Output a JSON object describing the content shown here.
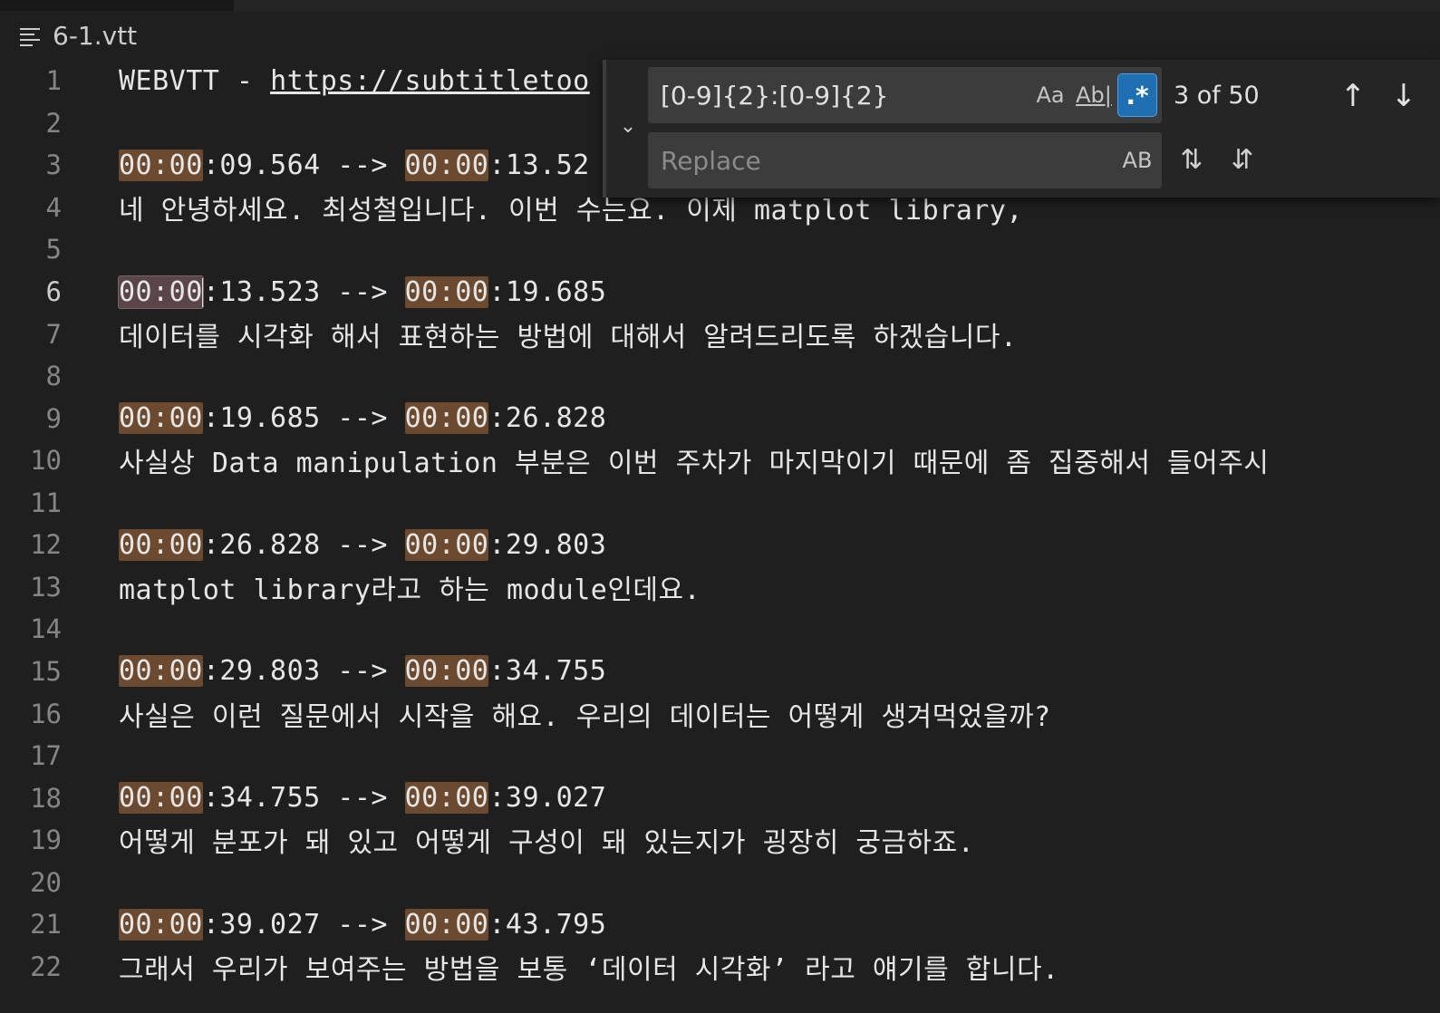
{
  "file": {
    "name": "6-1.vtt",
    "icon": "list-icon"
  },
  "lines": [
    {
      "n": "1",
      "text": "WEBVTT - https://subtitletoo"
    },
    {
      "n": "2",
      "text": ""
    },
    {
      "n": "3",
      "a": "00:00",
      "b": ":09.564 --> ",
      "c": "00:00",
      "d": ":13.52"
    },
    {
      "n": "4",
      "text": "네 안녕하세요. 최성철입니다. 이번 수는요. 이제 matplot library,"
    },
    {
      "n": "5",
      "text": ""
    },
    {
      "n": "6",
      "a": "00:00",
      "b": ":13.523 --> ",
      "c": "00:00",
      "d": ":19.685"
    },
    {
      "n": "7",
      "text": "데이터를 시각화 해서 표현하는 방법에 대해서 알려드리도록 하겠습니다."
    },
    {
      "n": "8",
      "text": ""
    },
    {
      "n": "9",
      "a": "00:00",
      "b": ":19.685 --> ",
      "c": "00:00",
      "d": ":26.828"
    },
    {
      "n": "10",
      "text": "사실상 Data manipulation 부분은 이번 주차가 마지막이기 때문에 좀 집중해서 들어주시"
    },
    {
      "n": "11",
      "text": ""
    },
    {
      "n": "12",
      "a": "00:00",
      "b": ":26.828 --> ",
      "c": "00:00",
      "d": ":29.803"
    },
    {
      "n": "13",
      "text": "matplot library라고 하는 module인데요."
    },
    {
      "n": "14",
      "text": ""
    },
    {
      "n": "15",
      "a": "00:00",
      "b": ":29.803 --> ",
      "c": "00:00",
      "d": ":34.755"
    },
    {
      "n": "16",
      "text": "사실은 이런 질문에서 시작을 해요. 우리의 데이터는 어떻게 생겨먹었을까?"
    },
    {
      "n": "17",
      "text": ""
    },
    {
      "n": "18",
      "a": "00:00",
      "b": ":34.755 --> ",
      "c": "00:00",
      "d": ":39.027"
    },
    {
      "n": "19",
      "text": "어떻게 분포가 돼 있고 어떻게 구성이 돼 있는지가 굉장히 궁금하죠."
    },
    {
      "n": "20",
      "text": ""
    },
    {
      "n": "21",
      "a": "00:00",
      "b": ":39.027 --> ",
      "c": "00:00",
      "d": ":43.795"
    },
    {
      "n": "22",
      "text": "그래서 우리가 보여주는 방법을 보통 ‘데이터 시각화’ 라고 얘기를 합니다."
    }
  ],
  "find": {
    "query": "[0-9]{2}:[0-9]{2}",
    "match_case_label": "Aa",
    "whole_word_label": "Ab|",
    "regex_label": ".*",
    "regex_enabled": true,
    "match_count": "3 of 50",
    "replace_placeholder": "Replace",
    "preserve_case_label": "AB",
    "prev_icon": "arrow-up-icon",
    "next_icon": "arrow-down-icon",
    "replace_icon": "replace-icon",
    "replace_all_icon": "replace-all-icon"
  }
}
